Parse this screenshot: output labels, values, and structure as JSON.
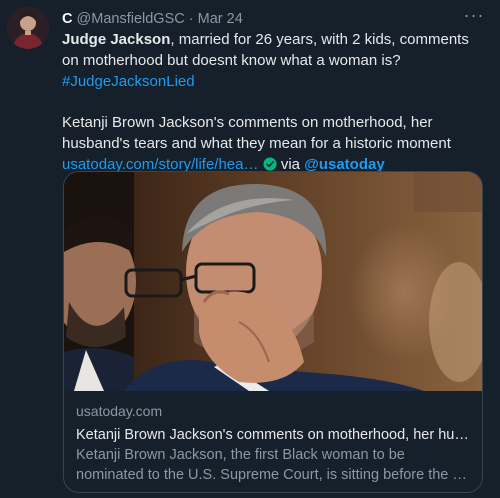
{
  "tweet": {
    "author_name": "C",
    "handle": "@MansfieldGSC",
    "separator": "·",
    "date": "Mar 24",
    "more_label": "···",
    "text_bold": "Judge Jackson",
    "text_rest": ", married for 26 years, with 2 kids, comments on motherhood but doesnt know what a woman is?",
    "hashtag": "#JudgeJacksonLied",
    "line2_text": "Ketanji Brown Jackson's comments on motherhood, her husband's tears and what they mean for a historic moment",
    "link_text": "usatoday.com/story/life/hea…",
    "via_label": "via",
    "via_handle": "@usatoday"
  },
  "card": {
    "domain": "usatoday.com",
    "title": "Ketanji Brown Jackson's comments on motherhood, her hus…",
    "description": "Ketanji Brown Jackson, the first Black woman to be nominated to the U.S. Supreme Court, is sitting before the …"
  },
  "colors": {
    "background": "#15202b",
    "link": "#1d9bf0",
    "muted": "#8b98a5",
    "verified": "#00ba7c"
  }
}
